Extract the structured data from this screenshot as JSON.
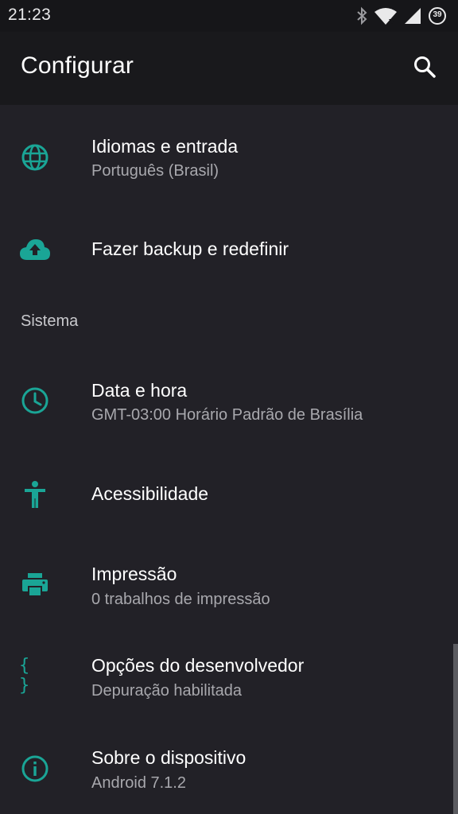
{
  "status_bar": {
    "time": "21:23",
    "battery_level": "39",
    "icons": [
      "bluetooth-icon",
      "wifi-icon",
      "signal-icon",
      "battery-icon"
    ]
  },
  "toolbar": {
    "title": "Configurar",
    "search_icon": "search-icon"
  },
  "colors": {
    "accent": "#1aa596",
    "background": "#222127",
    "toolbar": "#19191c",
    "status_bar": "#161619"
  },
  "items": [
    {
      "icon": "globe-icon",
      "title": "Idiomas e entrada",
      "summary": "Português (Brasil)"
    },
    {
      "icon": "cloud-upload-icon",
      "title": "Fazer backup e redefinir",
      "summary": ""
    },
    {
      "icon": "clock-icon",
      "title": "Data e hora",
      "summary": "GMT-03:00 Horário Padrão de Brasília"
    },
    {
      "icon": "accessibility-icon",
      "title": "Acessibilidade",
      "summary": ""
    },
    {
      "icon": "printer-icon",
      "title": "Impressão",
      "summary": "0 trabalhos de impressão"
    },
    {
      "icon": "braces-icon",
      "title": "Opções do desenvolvedor",
      "summary": "Depuração habilitada",
      "icon_text": "{ }"
    },
    {
      "icon": "info-icon",
      "title": "Sobre o dispositivo",
      "summary": "Android 7.1.2"
    }
  ],
  "sections": {
    "sistema": "Sistema"
  }
}
